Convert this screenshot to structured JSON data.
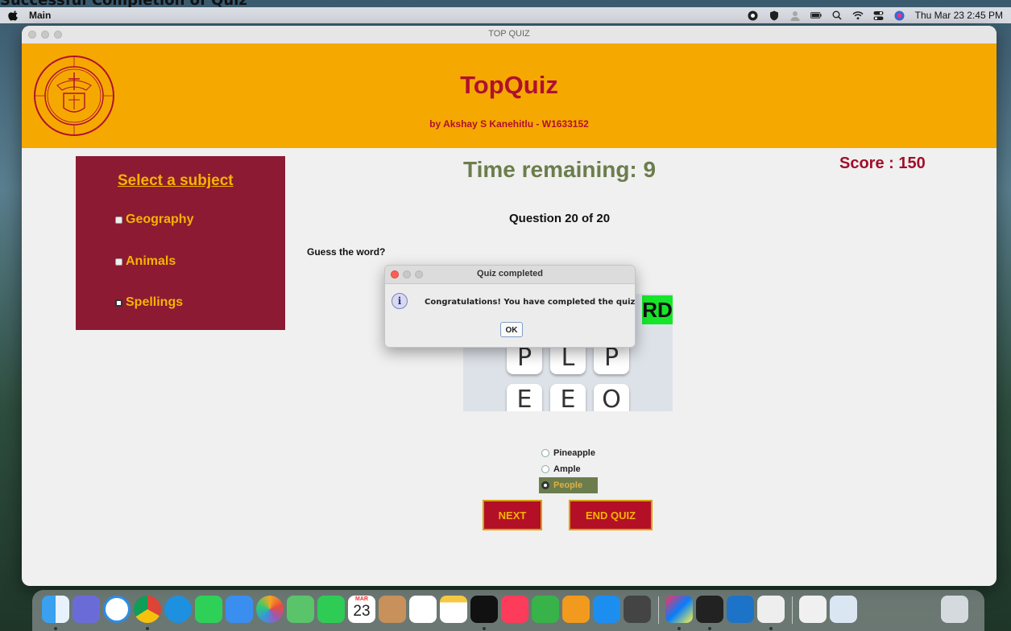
{
  "document": {
    "heading": "Successful Completion of Quiz"
  },
  "menubar": {
    "app_name": "Main",
    "clock": "Thu Mar 23  2:45 PM"
  },
  "window": {
    "title": "TOP QUIZ"
  },
  "banner": {
    "title": "TopQuiz",
    "subtitle": "by Akshay S Kanehitlu - W1633152"
  },
  "subjects": {
    "title": "Select a subject",
    "items": [
      {
        "label": "Geography",
        "selected": false
      },
      {
        "label": "Animals",
        "selected": false
      },
      {
        "label": "Spellings",
        "selected": true
      }
    ]
  },
  "quiz": {
    "timer": "Time remaining: 9",
    "score": "Score : 150",
    "question_number": "Question 20 of 20",
    "question": "Guess the word?",
    "puzzle_tiles_top": [
      "P",
      "L",
      "P"
    ],
    "puzzle_tiles_bottom": [
      "E",
      "E",
      "O"
    ],
    "puzzle_green_text": "RD",
    "answers": [
      {
        "label": "Pineapple",
        "selected": false
      },
      {
        "label": "Ample",
        "selected": false
      },
      {
        "label": "People",
        "selected": true
      }
    ],
    "next_label": "NEXT",
    "end_label": "END QUIZ"
  },
  "dialog": {
    "title": "Quiz completed",
    "message": "Congratulations! You have completed the quiz.",
    "ok_label": "OK"
  },
  "dock": {
    "calendar_month": "MAR",
    "calendar_day": "23"
  },
  "colors": {
    "banner": "#f5a800",
    "maroon": "#8c1a33",
    "gold": "#f5b400",
    "olive": "#6b7d4c",
    "button": "#b31028"
  }
}
